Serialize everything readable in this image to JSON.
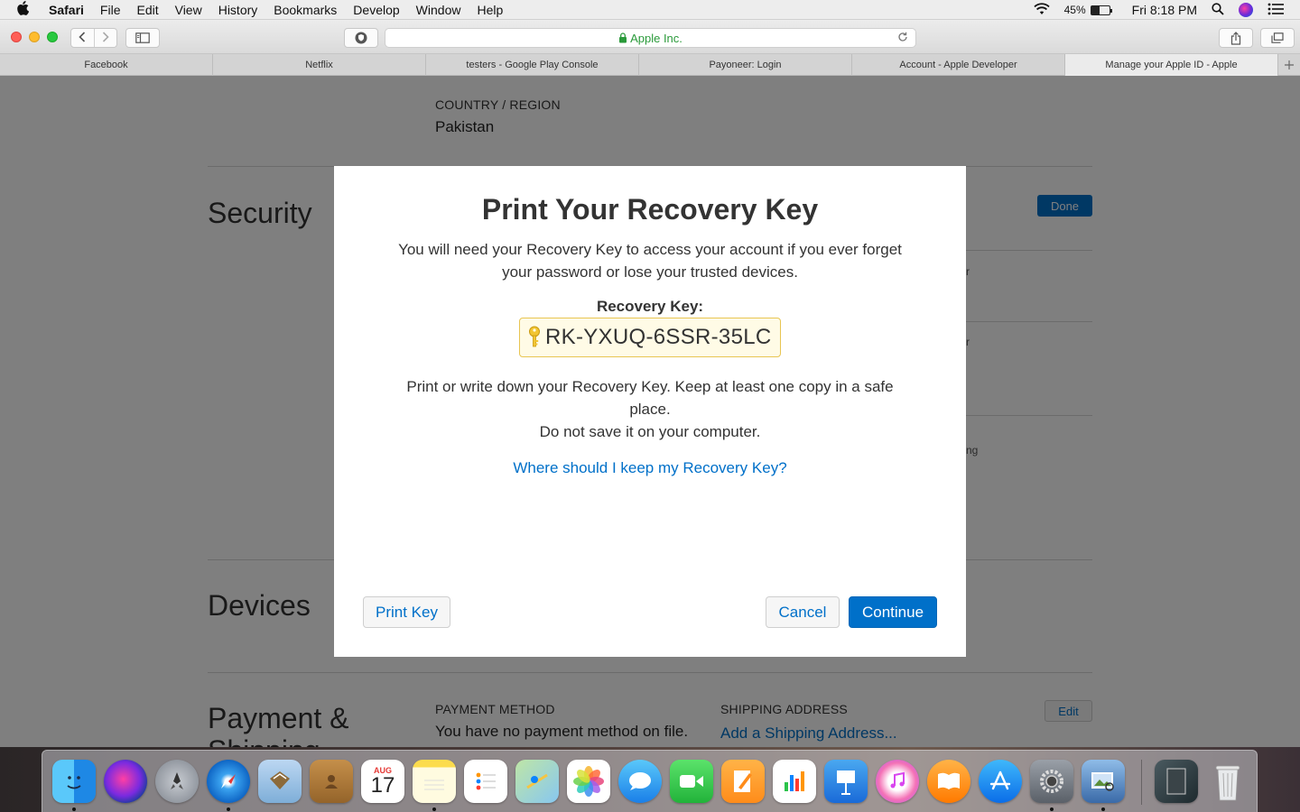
{
  "menubar": {
    "app": "Safari",
    "items": [
      "File",
      "Edit",
      "View",
      "History",
      "Bookmarks",
      "Develop",
      "Window",
      "Help"
    ],
    "battery_percent": "45%",
    "battery_level": 0.45,
    "clock": "Fri 8:18 PM"
  },
  "toolbar": {
    "address_text": "Apple Inc."
  },
  "tabs": [
    {
      "label": "Facebook",
      "active": false
    },
    {
      "label": "Netflix",
      "active": false
    },
    {
      "label": "testers - Google Play Console",
      "active": false
    },
    {
      "label": "Payoneer: Login",
      "active": false
    },
    {
      "label": "Account - Apple Developer",
      "active": false
    },
    {
      "label": "Manage your Apple ID - Apple",
      "active": true
    }
  ],
  "page": {
    "country_label": "COUNTRY / REGION",
    "country_value": "Pakistan",
    "security_heading": "Security",
    "done_label": "Done",
    "devices_heading": "Devices",
    "payment_heading": "Payment &",
    "payment_heading_cut": "Shipping",
    "payment_method_label": "PAYMENT METHOD",
    "payment_method_value": "You have no payment method on file.",
    "shipping_label": "SHIPPING ADDRESS",
    "shipping_link": "Add a Shipping Address...",
    "edit_label": "Edit",
    "frag1": "r",
    "frag2": "r",
    "frag3": "ng"
  },
  "modal": {
    "title": "Print Your Recovery Key",
    "intro": "You will need your Recovery Key to access your account if you ever forget your password or lose your trusted devices.",
    "key_label": "Recovery Key:",
    "key_value": "RK-YXUQ-6SSR-35LC",
    "notice_line1": "Print or write down your Recovery Key. Keep at least one copy in a safe place.",
    "notice_line2": "Do not save it on your computer.",
    "help_link": "Where should I keep my Recovery Key?",
    "print_button": "Print Key",
    "cancel_button": "Cancel",
    "continue_button": "Continue"
  },
  "dock": {
    "calendar_month": "AUG",
    "calendar_day": "17"
  },
  "colors": {
    "accent": "#0070c9",
    "key_box_bg": "#fffbe6",
    "key_box_border": "#e8c552",
    "lock_green": "#2a9a3a"
  }
}
